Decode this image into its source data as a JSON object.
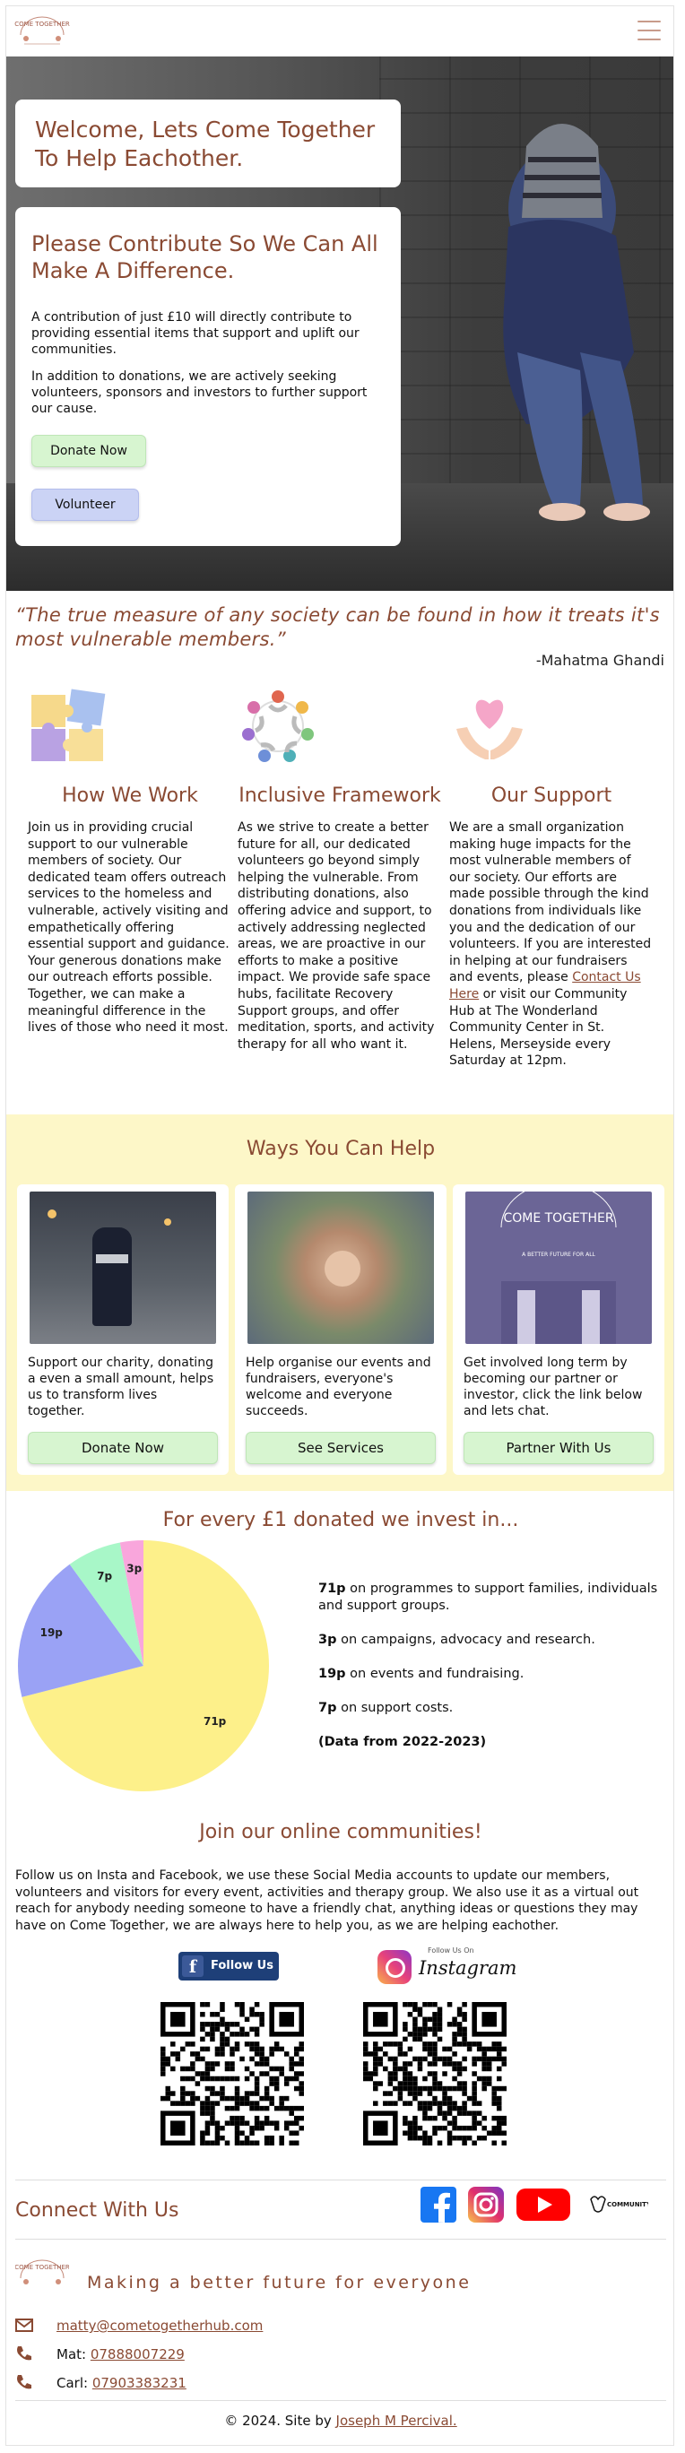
{
  "header": {
    "menu_icon": "hamburger-menu-icon",
    "logo_text": "COME TOGETHER"
  },
  "hero": {
    "welcome_title": "Welcome, Lets Come Together To Help Eachother.",
    "contribute_title": "Please Contribute So We Can All Make A Difference.",
    "paragraph_1": "A contribution of just £10 will directly contribute to providing essential items that support and uplift our communities.",
    "paragraph_2": "In addition to donations, we are actively seeking volunteers, sponsors and investors to further support our cause.",
    "donate_label": "Donate Now",
    "volunteer_label": "Volunteer"
  },
  "quote": {
    "text": "“The true measure of any society can be found in how it treats it's most vulnerable members.”",
    "author": "-Mahatma Ghandi"
  },
  "features": [
    {
      "icon": "puzzle-pieces-icon",
      "title": "How We Work",
      "text": "Join us in providing crucial support to our vulnerable members of society. Our dedicated team offers outreach services to the homeless and vulnerable, actively visiting and empathetically offering essential support and guidance. Your generous donations make our outreach efforts possible. Together, we can make a meaningful difference in the lives of those who need it most."
    },
    {
      "icon": "people-circle-icon",
      "title": "Inclusive Framework",
      "text": "As we strive to create a better future for all, our dedicated volunteers go beyond simply helping the vulnerable. From distributing donations, also offering advice and support, to actively addressing neglected areas, we are proactive in our efforts to make a positive impact. We provide safe space hubs, facilitate Recovery Support groups, and offer meditation, sports, and activity therapy for all who want it."
    },
    {
      "icon": "heart-hands-icon",
      "title": "Our Support",
      "text_before": "We are a small organization making huge impacts for the most vulnerable members of our society. Our efforts are made possible through the kind donations from individuals like you and the dedication of our volunteers. If you are interested in helping at our fundraisers and events, please ",
      "link": "Contact Us Here",
      "text_after": " or visit our Community Hub at The Wonderland Community Center in St. Helens, Merseyside every Saturday at 12pm."
    }
  ],
  "ways": {
    "title": "Ways You Can Help",
    "cards": [
      {
        "text": "Support our charity, donating a even a small amount, helps us to transform lives together.",
        "button": "Donate Now"
      },
      {
        "text": "Help organise our events and fundraisers, everyone's welcome and everyone succeeds.",
        "button": "See Services"
      },
      {
        "text": "Get involved long term by becoming our partner or investor, click the link below and lets chat.",
        "button": "Partner With Us",
        "image_text_1": "COME TOGETHER",
        "image_text_2": "A BETTER FUTURE FOR ALL"
      }
    ]
  },
  "donation": {
    "title": "For every £1 donated we invest in...",
    "items": [
      {
        "amount": "71p",
        "text": " on programmes to support families, individuals and support groups."
      },
      {
        "amount": "3p",
        "text": " on campaigns, advocacy and research."
      },
      {
        "amount": "19p",
        "text": " on events and fundraising."
      },
      {
        "amount": "7p",
        "text": " on support costs."
      }
    ],
    "note": "(Data from 2022-2023)"
  },
  "chart_data": {
    "type": "pie",
    "categories": [
      "71p",
      "19p",
      "7p",
      "3p"
    ],
    "values": [
      71,
      19,
      7,
      3
    ],
    "colors": [
      "#fdf08a",
      "#9aa2f5",
      "#a8f7c8",
      "#f9a6dc"
    ],
    "title": ""
  },
  "community": {
    "title": "Join our online communities!",
    "text": "Follow us on Insta and Facebook, we use these Social Media accounts to update our members, volunteers and visitors for every event, activities and therapy group. We also use it as a virtual out reach for anybody needing someone to have a friendly chat, anything ideas or questions they may have on Come Together, we are always here to help you, as we are helping eachother.",
    "fb_label": "Follow Us",
    "ig_small": "Follow Us On",
    "ig_word": "Instagram"
  },
  "connect": {
    "title": "Connect With Us",
    "icons": [
      "facebook-icon",
      "instagram-icon",
      "youtube-icon",
      "community-fund-icon"
    ],
    "community_fund_label": "COMMUNITY FUND",
    "tagline": "Making a better future for everyone",
    "email": "matty@cometogetherhub.com",
    "phone1_label": "Mat: ",
    "phone1": "07888007229",
    "phone2_label": "Carl: ",
    "phone2": "07903383231"
  },
  "footer": {
    "text": "© 2024. Site by ",
    "link": "Joseph M Percival."
  }
}
